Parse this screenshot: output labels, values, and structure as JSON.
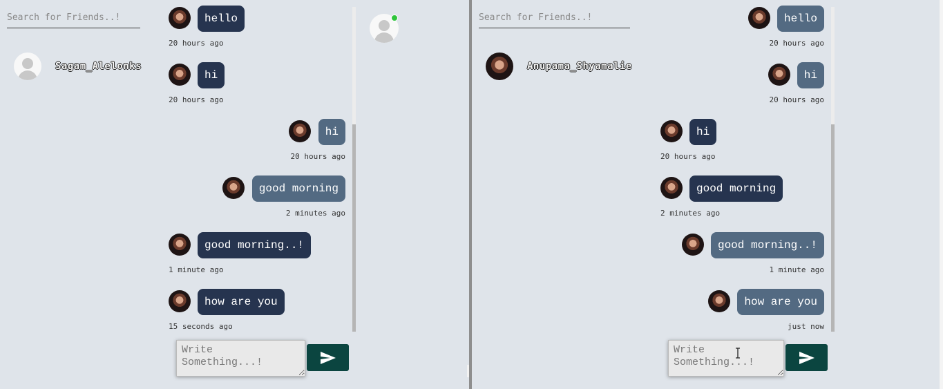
{
  "left": {
    "search_placeholder": "Search for Friends..!",
    "friend": {
      "name": "Sagam_Alelonks",
      "avatar": "default-user-icon"
    },
    "messages": [
      {
        "side": "recv",
        "text": "hello",
        "time": "20 hours ago"
      },
      {
        "side": "recv",
        "text": "hi",
        "time": "20 hours ago"
      },
      {
        "side": "sent",
        "text": "hi",
        "time": "20 hours ago"
      },
      {
        "side": "sent",
        "text": "good morning",
        "time": "2 minutes ago"
      },
      {
        "side": "recv",
        "text": "good morning..!",
        "time": "1 minute ago"
      },
      {
        "side": "recv",
        "text": "how are you",
        "time": "15 seconds ago"
      }
    ],
    "composer_placeholder": "Write Something...!",
    "online_status": "online"
  },
  "right": {
    "search_placeholder": "Search for Friends..!",
    "friend": {
      "name": "Anupama_Shyamalie",
      "avatar": "profile-photo"
    },
    "messages": [
      {
        "side": "sent",
        "text": "hello",
        "time": "20 hours ago"
      },
      {
        "side": "sent",
        "text": "hi",
        "time": "20 hours ago"
      },
      {
        "side": "recv",
        "text": "hi",
        "time": "20 hours ago"
      },
      {
        "side": "recv",
        "text": "good morning",
        "time": "2 minutes ago"
      },
      {
        "side": "sent",
        "text": "good morning..!",
        "time": "1 minute ago"
      },
      {
        "side": "sent",
        "text": "how are you",
        "time": "just now"
      }
    ],
    "composer_placeholder": "Write Something...!"
  },
  "colors": {
    "background": "#dfe4ea",
    "received_bubble": "#26344f",
    "sent_bubble": "#536a82",
    "send_button": "#0b4540",
    "online_dot": "#2ec43b"
  },
  "icons": {
    "send": "send-icon",
    "default_avatar": "user-icon"
  }
}
